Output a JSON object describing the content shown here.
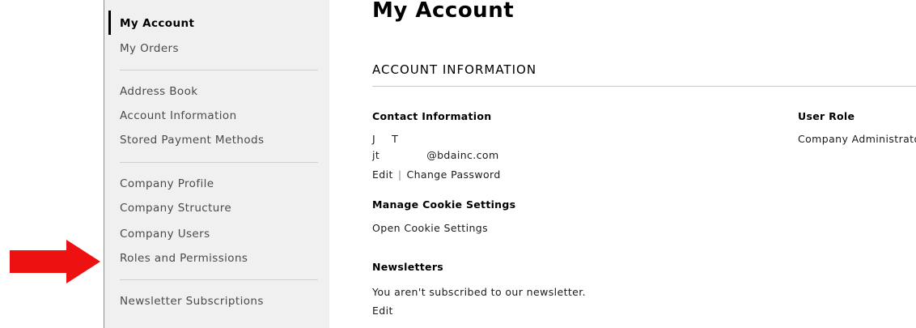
{
  "sidebar": {
    "items": [
      {
        "label": "My Account",
        "active": true
      },
      {
        "label": "My Orders"
      },
      {
        "label": "Address Book"
      },
      {
        "label": "Account Information"
      },
      {
        "label": "Stored Payment Methods"
      },
      {
        "label": "Company Profile"
      },
      {
        "label": "Company Structure"
      },
      {
        "label": "Company Users"
      },
      {
        "label": "Roles and Permissions"
      },
      {
        "label": "Newsletter Subscriptions"
      }
    ]
  },
  "main": {
    "page_title": "My Account",
    "section_title": "ACCOUNT INFORMATION",
    "contact": {
      "title": "Contact Information",
      "name_first": "J",
      "name_last": "T",
      "email_user": "jt",
      "email_domain": "@bdainc.com",
      "edit_label": "Edit",
      "separator": "|",
      "change_password_label": "Change Password"
    },
    "user_role": {
      "title": "User Role",
      "value": "Company Administrator"
    },
    "cookies": {
      "title": "Manage Cookie Settings",
      "open_label": "Open Cookie Settings"
    },
    "newsletters": {
      "title": "Newsletters",
      "status": "You aren't subscribed to our newsletter.",
      "edit_label": "Edit"
    }
  },
  "colors": {
    "annotation_arrow": "#ee1111",
    "sidebar_bg": "#f0f0f0"
  },
  "icons": {
    "annotation": "red-arrow-icon"
  }
}
